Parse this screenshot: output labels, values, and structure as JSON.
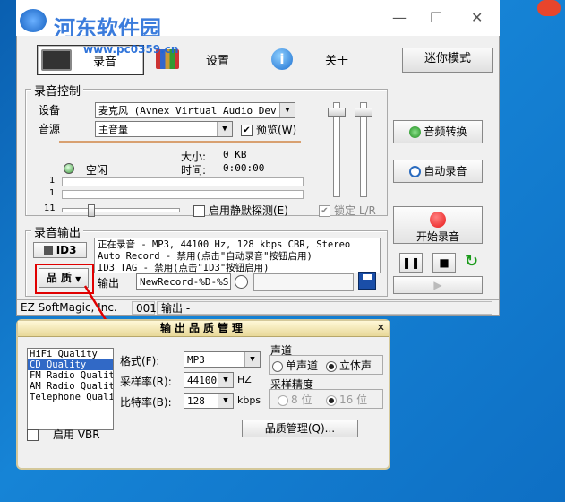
{
  "watermark": {
    "site_name": "河东软件园",
    "url": "www.pc0359.cn"
  },
  "toolbar": {
    "record_label": "录音",
    "settings_label": "设置",
    "about_label": "关于",
    "mini_mode_label": "迷你模式"
  },
  "record_control": {
    "title": "录音控制",
    "device_label": "设备",
    "device_value": "麦克风 (Avnex Virtual Audio Dev",
    "source_label": "音源",
    "source_value": "主音量",
    "preview_label": "预览(W)",
    "preview_checked": true,
    "size_label": "大小:",
    "size_value": "0 KB",
    "time_label": "时间:",
    "time_value": "0:00:00",
    "state_label": "空闲",
    "channel_1": "1",
    "channel_2": "1",
    "slider_value": "11",
    "silence_detect_label": "启用静默探测(E)",
    "lock_label": "锁定 L/R",
    "lock_checked": true
  },
  "right_buttons": {
    "audio_convert": "音频转换",
    "auto_record": "自动录音",
    "start_record": "开始录音"
  },
  "record_output": {
    "title": "录音输出",
    "id3_label": "ID3",
    "quality_label": "品 质",
    "info_line1": "正在录音 - MP3, 44100 Hz, 128 kbps CBR, Stereo",
    "info_line2": "Auto Record - 禁用(点击\"自动录音\"按钮启用)",
    "info_line3": "ID3 TAG - 禁用(点击\"ID3\"按钮启用)",
    "output_label": "输出",
    "output_value": "NewRecord-%D-%S"
  },
  "statusbar": {
    "company": "EZ SoftMagic, Inc.",
    "number": "001",
    "output": "输出 -"
  },
  "quality_dialog": {
    "title": "输出品质管理",
    "presets": [
      "HiFi Quality",
      "CD Quality",
      "FM Radio Quality",
      "AM Radio Quality",
      "Telephone Quality"
    ],
    "selected_preset": "CD Quality",
    "format_label": "格式(F):",
    "format_value": "MP3",
    "samplerate_label": "采样率(R):",
    "samplerate_value": "44100",
    "samplerate_unit": "HZ",
    "bitrate_label": "比特率(B):",
    "bitrate_value": "128",
    "bitrate_unit": "kbps",
    "channel_title": "声道",
    "mono_label": "单声道",
    "stereo_label": "立体声",
    "precision_title": "采样精度",
    "bit8_label": "8 位",
    "bit16_label": "16 位",
    "vbr_label": "启用 VBR",
    "manage_button": "品质管理(Q)..."
  },
  "colors": {
    "accent_red": "#e00000",
    "selection_blue": "#3169c6",
    "record_red": "#e81818"
  }
}
